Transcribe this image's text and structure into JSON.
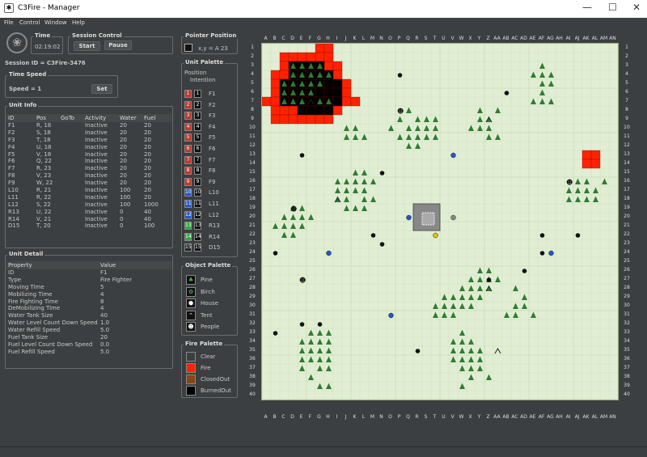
{
  "window": {
    "title": "C3Fire - Manager",
    "min": "—",
    "max": "☐",
    "close": "✕"
  },
  "menu": [
    "File",
    "Control",
    "Window",
    "Help"
  ],
  "time": {
    "label": "Time",
    "value": "02:19:02"
  },
  "session_control": {
    "label": "Session Control",
    "start": "Start",
    "pause": "Pause"
  },
  "session_id": "Session ID = C3Fire-3476",
  "time_speed": {
    "label": "Time Speed",
    "text": "Speed = 1",
    "set": "Set"
  },
  "unit_info": {
    "label": "Unit Info",
    "headers": [
      "ID",
      "Pos",
      "GoTo",
      "Activity",
      "Water",
      "Fuel"
    ],
    "rows": [
      [
        "F1",
        "R, 18",
        "",
        "Inactive",
        "20",
        "20"
      ],
      [
        "F2",
        "S, 18",
        "",
        "Inactive",
        "20",
        "20"
      ],
      [
        "F3",
        "T, 18",
        "",
        "Inactive",
        "20",
        "20"
      ],
      [
        "F4",
        "U, 18",
        "",
        "Inactive",
        "20",
        "20"
      ],
      [
        "F5",
        "V, 18",
        "",
        "Inactive",
        "20",
        "20"
      ],
      [
        "F6",
        "Q, 22",
        "",
        "Inactive",
        "20",
        "20"
      ],
      [
        "F7",
        "R, 23",
        "",
        "Inactive",
        "20",
        "20"
      ],
      [
        "F8",
        "V, 23",
        "",
        "Inactive",
        "20",
        "20"
      ],
      [
        "F9",
        "W, 22",
        "",
        "Inactive",
        "20",
        "20"
      ],
      [
        "L10",
        "R, 21",
        "",
        "Inactive",
        "100",
        "20"
      ],
      [
        "L11",
        "R, 22",
        "",
        "Inactive",
        "100",
        "20"
      ],
      [
        "L12",
        "S, 22",
        "",
        "Inactive",
        "100",
        "1000"
      ],
      [
        "R13",
        "U, 22",
        "",
        "Inactive",
        "0",
        "40"
      ],
      [
        "R14",
        "V, 21",
        "",
        "Inactive",
        "0",
        "40"
      ],
      [
        "D15",
        "T, 20",
        "",
        "Inactive",
        "0",
        "100"
      ]
    ]
  },
  "unit_detail": {
    "label": "Unit Detail",
    "headers": [
      "Property",
      "Value"
    ],
    "rows": [
      [
        "ID",
        "F1"
      ],
      [
        "Type",
        "Fire Fighter"
      ],
      [
        "Moving Time",
        "5"
      ],
      [
        "Mobilizing Time",
        "4"
      ],
      [
        "Fire Fighting Time",
        "8"
      ],
      [
        "DeMobilizing Time",
        "4"
      ],
      [
        "Water Tank Size",
        "40"
      ],
      [
        "Water Level Count Down Speed",
        "1.0"
      ],
      [
        "Water Refill Speed",
        "5.0"
      ],
      [
        "Fuel Tank Size",
        "20"
      ],
      [
        "Fuel Level Count Down Speed",
        "0.0"
      ],
      [
        "Fuel Refill Speed",
        "5.0"
      ]
    ]
  },
  "pointer": {
    "label": "Pointer Position",
    "text": "x,y =    A 23"
  },
  "unit_palette": {
    "label": "Unit Palette",
    "pos": "Position",
    "intent": "Intention",
    "units": [
      {
        "n": "1",
        "name": "F1",
        "c": "#c0392b"
      },
      {
        "n": "2",
        "name": "F2",
        "c": "#c0392b"
      },
      {
        "n": "3",
        "name": "F3",
        "c": "#c0392b"
      },
      {
        "n": "4",
        "name": "F4",
        "c": "#c0392b"
      },
      {
        "n": "5",
        "name": "F5",
        "c": "#c0392b"
      },
      {
        "n": "6",
        "name": "F6",
        "c": "#c0392b"
      },
      {
        "n": "7",
        "name": "F7",
        "c": "#c0392b"
      },
      {
        "n": "8",
        "name": "F8",
        "c": "#c0392b"
      },
      {
        "n": "9",
        "name": "F9",
        "c": "#c0392b"
      },
      {
        "n": "10",
        "name": "L10",
        "c": "#2456c9"
      },
      {
        "n": "11",
        "name": "L11",
        "c": "#2456c9"
      },
      {
        "n": "12",
        "name": "L12",
        "c": "#2456c9"
      },
      {
        "n": "13",
        "name": "R13",
        "c": "#27ae3a"
      },
      {
        "n": "14",
        "name": "R14",
        "c": "#27ae3a"
      },
      {
        "n": "15",
        "name": "D15",
        "c": "#222222"
      }
    ]
  },
  "object_palette": {
    "label": "Object Palette",
    "items": [
      {
        "name": "Pine",
        "icon": "pine-icon"
      },
      {
        "name": "Birch",
        "icon": "birch-icon"
      },
      {
        "name": "House",
        "icon": "house-icon"
      },
      {
        "name": "Tent",
        "icon": "tent-icon"
      },
      {
        "name": "People",
        "icon": "people-icon"
      }
    ]
  },
  "fire_palette": {
    "label": "Fire Palette",
    "items": [
      {
        "name": "Clear",
        "c": "#3c3f41"
      },
      {
        "name": "Fire",
        "c": "#ff2200"
      },
      {
        "name": "ClosedOut",
        "c": "#8b4513"
      },
      {
        "name": "BurnedOut",
        "c": "#000000"
      }
    ]
  },
  "map": {
    "cols": [
      "A",
      "B",
      "C",
      "D",
      "E",
      "F",
      "G",
      "H",
      "I",
      "J",
      "K",
      "L",
      "M",
      "N",
      "O",
      "P",
      "Q",
      "R",
      "S",
      "T",
      "U",
      "V",
      "W",
      "X",
      "Y",
      "Z",
      "AA",
      "AB",
      "AC",
      "AD",
      "AE",
      "AF",
      "AG",
      "AH",
      "AI",
      "AJ",
      "AK",
      "AL",
      "AM",
      "AN"
    ],
    "rows": 40,
    "colors": {
      "grass": "#e2eed4",
      "fire": "#ff2200",
      "burned": "#000000",
      "tree": "#2e7d32",
      "house": "#111111",
      "grid": "#c9d9b8"
    }
  }
}
